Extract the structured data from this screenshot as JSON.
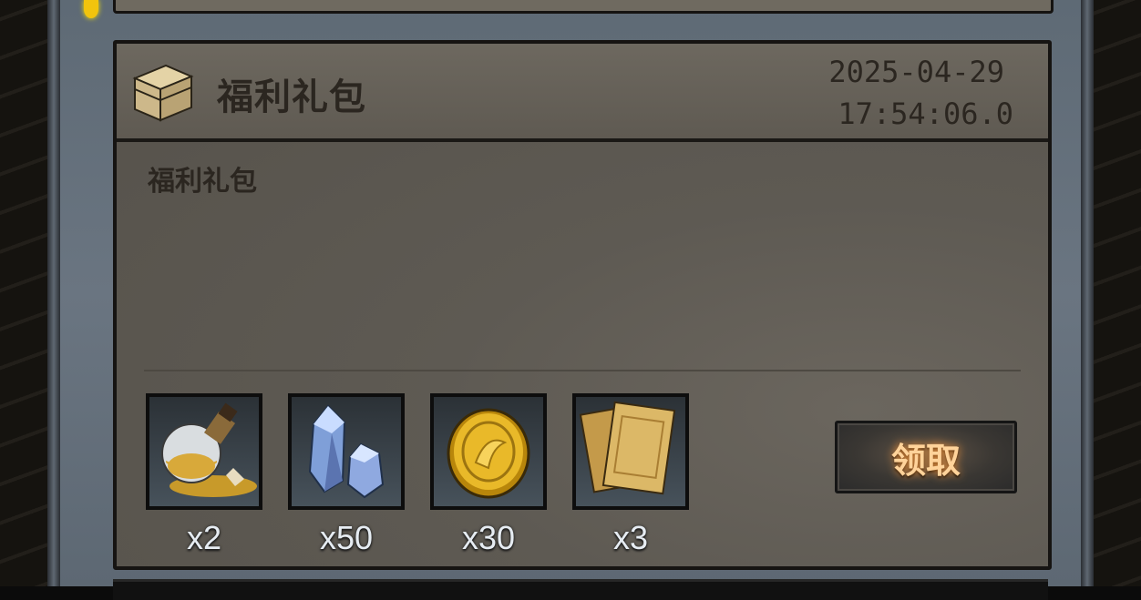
{
  "mail": {
    "title": "福利礼包",
    "date": "2025-04-29",
    "time": "17:54:06.0",
    "body": "福利礼包",
    "claim_label": "领取",
    "rewards": [
      {
        "icon": "gold-dust-flask-icon",
        "qty": "x2"
      },
      {
        "icon": "blue-crystal-icon",
        "qty": "x50"
      },
      {
        "icon": "gold-coin-icon",
        "qty": "x30"
      },
      {
        "icon": "parchment-cards-icon",
        "qty": "x3"
      }
    ]
  },
  "colors": {
    "panel": "#6a7581",
    "card": "#5e5a53",
    "text_dark": "#2b2620",
    "button_glow": "#ffd39a"
  }
}
